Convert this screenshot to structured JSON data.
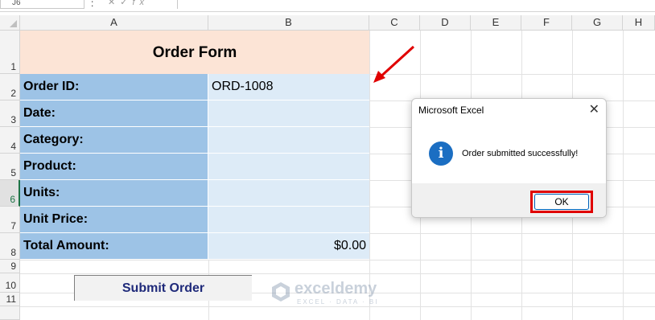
{
  "formula_bar": {
    "name_box": "J6",
    "separator": ":",
    "fx_label": "fx"
  },
  "columns": [
    "A",
    "B",
    "C",
    "D",
    "E",
    "F",
    "G",
    "H"
  ],
  "rows": [
    "1",
    "2",
    "3",
    "4",
    "5",
    "6",
    "7",
    "8",
    "9",
    "10",
    "11"
  ],
  "active_row": "6",
  "form": {
    "title": "Order Form",
    "fields": [
      {
        "label": "Order ID:",
        "value": "ORD-1008"
      },
      {
        "label": "Date:",
        "value": ""
      },
      {
        "label": "Category:",
        "value": ""
      },
      {
        "label": "Product:",
        "value": ""
      },
      {
        "label": "Units:",
        "value": ""
      },
      {
        "label": "Unit Price:",
        "value": ""
      },
      {
        "label": "Total Amount:",
        "value": "$0.00"
      }
    ]
  },
  "submit_button": {
    "label": "Submit Order"
  },
  "watermark": {
    "name": "exceldemy",
    "tagline": "EXCEL · DATA · BI"
  },
  "dialog": {
    "title": "Microsoft Excel",
    "close_glyph": "✕",
    "icon": "information-icon",
    "message": "Order submitted successfully!",
    "ok_label": "OK"
  },
  "colors": {
    "title_fill": "#fce4d6",
    "label_fill": "#9dc3e6",
    "value_fill": "#ddebf7",
    "annotation_red": "#e00000",
    "info_blue": "#1b6ec2"
  }
}
